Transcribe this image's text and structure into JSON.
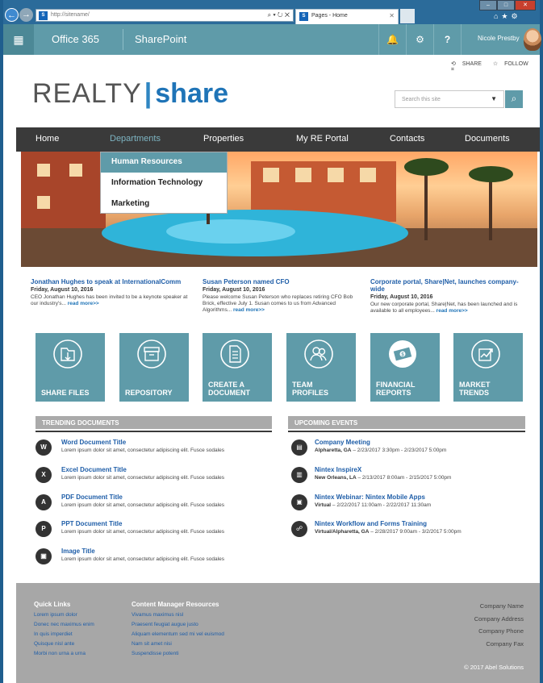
{
  "browser": {
    "url": "http://sitename/",
    "tab_title": "Pages - Home",
    "sp_badge": "S"
  },
  "suite": {
    "app": "Office 365",
    "site": "SharePoint",
    "user": "Nicole Prestby"
  },
  "actions": {
    "share": "SHARE",
    "follow": "FOLLOW"
  },
  "logo": {
    "part1": "REALTY",
    "pipe": "|",
    "part2": "share"
  },
  "search": {
    "placeholder": "Search this site"
  },
  "nav": {
    "items": [
      "Home",
      "Departments",
      "Properties",
      "My RE Portal",
      "Contacts",
      "Documents"
    ],
    "active": "Departments",
    "dropdown": [
      "Human Resources",
      "Information Technology",
      "Marketing"
    ],
    "dropdown_selected": "Human Resources"
  },
  "news": [
    {
      "title": "Jonathan Hughes to speak at InternationalComm",
      "date": "Friday, August 10, 2016",
      "body": "CEO Jonathan Hughes has been invited to be a keynote speaker at our industry's...",
      "more": "read more>>"
    },
    {
      "title": "Susan Peterson named CFO",
      "date": "Friday, August 10, 2016",
      "body": "Please welcome Susan Peterson who replaces retiring CFO Bob Brick, effective July 1. Susan comes to us from Advanced Algorithms...",
      "more": "read more>>"
    },
    {
      "title": "Corporate portal, Share|Net, launches company-wide",
      "date": "Friday, August 10, 2016",
      "body": "Our new corporate portal, Share|Net, has been launched and is available to all employees...",
      "more": "read more>>"
    }
  ],
  "tiles": [
    {
      "l1": "SHARE FILES",
      "l2": ""
    },
    {
      "l1": "REPOSITORY",
      "l2": ""
    },
    {
      "l1": "CREATE A",
      "l2": "DOCUMENT"
    },
    {
      "l1": "TEAM",
      "l2": "PROFILES"
    },
    {
      "l1": "FINANCIAL",
      "l2": "REPORTS"
    },
    {
      "l1": "MARKET",
      "l2": "TRENDS"
    }
  ],
  "trending": {
    "header": "TRENDING DOCUMENTS",
    "items": [
      {
        "icon": "W",
        "title": "Word Document Title",
        "desc": "Lorem ipsum dolor sit amet, consectetur adipiscing elit. Fusce sodales"
      },
      {
        "icon": "X",
        "title": "Excel Document Title",
        "desc": "Lorem ipsum dolor sit amet, consectetur adipiscing elit. Fusce sodales"
      },
      {
        "icon": "A",
        "title": "PDF Document Title",
        "desc": "Lorem ipsum dolor sit amet, consectetur adipiscing elit. Fusce sodales"
      },
      {
        "icon": "P",
        "title": "PPT Document Title",
        "desc": "Lorem ipsum dolor sit amet, consectetur adipiscing elit. Fusce sodales"
      },
      {
        "icon": "▣",
        "title": "Image Title",
        "desc": "Lorem ipsum dolor sit amet, consectetur adipiscing elit. Fusce sodales"
      }
    ]
  },
  "events": {
    "header": "UPCOMING EVENTS",
    "items": [
      {
        "title": "Company Meeting",
        "location": "Alpharetta, GA",
        "time": " – 2/23/2017 3:30pm - 2/23/2017 5:00pm"
      },
      {
        "title": "Nintex InspireX",
        "location": "New Orleans, LA",
        "time": " – 2/13/2017 8:00am - 2/15/2017 5:00pm"
      },
      {
        "title": "Nintex Webinar: Nintex Mobile Apps",
        "location": "Virtual",
        "time": " – 2/22/2017 11:00am - 2/22/2017 11:30am"
      },
      {
        "title": "Nintex Workflow and Forms Training",
        "location": "Virtual/Alpharetta, GA",
        "time": " – 2/28/2017 9:00am - 3/2/2017 5:00pm"
      }
    ]
  },
  "footer": {
    "quick_links_header": "Quick Links",
    "quick_links": [
      "Lorem ipsum dolor",
      "Donec nec maximus enim",
      "In quis imperdiet",
      "Quisque nisl ante",
      "Morbi non urna a urna"
    ],
    "cm_header": "Content Manager Resources",
    "cm_links": [
      "Vivamus maximus nisl",
      "Praesent feugiat augue justo",
      "Aliquam elementum sed mi vel euismod",
      "Nam sit amet nisi",
      "Suspendisse potenti"
    ],
    "company": [
      "Company Name",
      "Company Address",
      "Company Phone",
      "Company Fax"
    ],
    "copyright": "© 2017 Abel Solutions"
  }
}
